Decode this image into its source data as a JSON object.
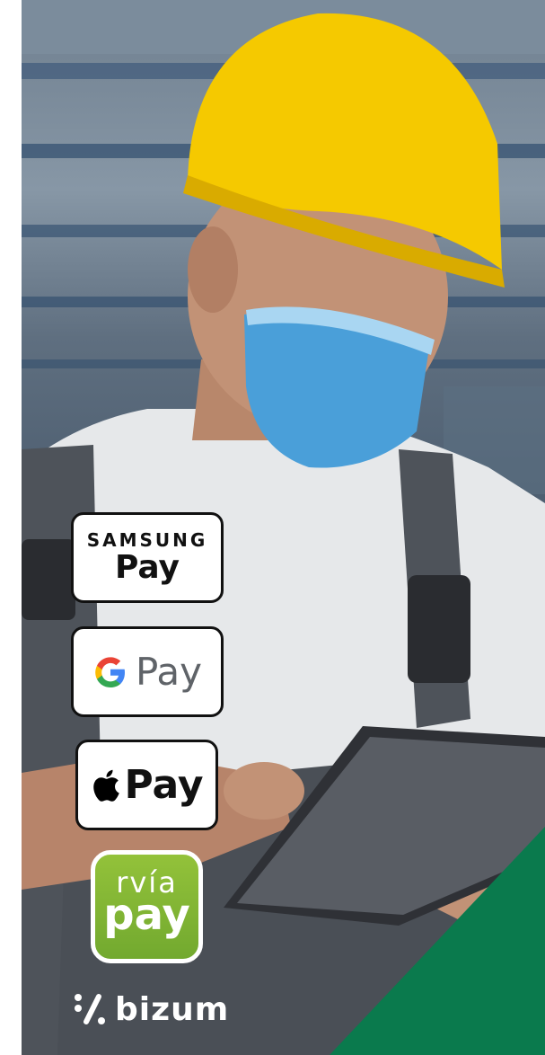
{
  "photo": {
    "description_icon": "worker-with-helmet-and-mask-using-tablet-photo"
  },
  "payment_methods": {
    "samsung_pay": {
      "top": "SAMSUNG",
      "bottom": "Pay"
    },
    "google_pay": {
      "logo": "google-g-icon",
      "label": "Pay"
    },
    "apple_pay": {
      "logo": "apple-icon",
      "label": "Pay"
    },
    "rvia_pay": {
      "top": "rvía",
      "bottom": "pay",
      "color": "#7bb434"
    },
    "bizum": {
      "logo": "bizum-icon",
      "label": "bizum"
    }
  },
  "colors": {
    "accent_green": "#0a7a4d",
    "helmet_yellow": "#f5c900",
    "mask_blue": "#4a9fd9"
  }
}
